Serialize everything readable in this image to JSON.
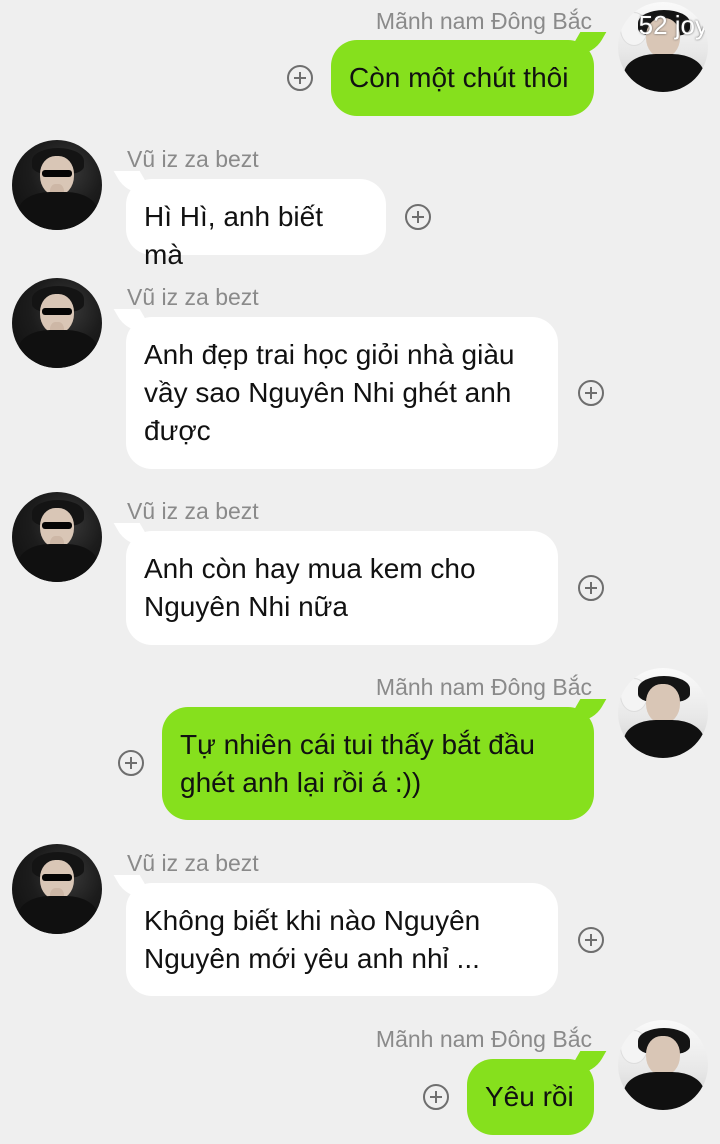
{
  "colors": {
    "background": "#efefef",
    "incoming_bubble": "#ffffff",
    "outgoing_bubble": "#86e01d",
    "sender_name": "#8a8a8a"
  },
  "overlay_text": "52 joy",
  "messages": [
    {
      "direction": "outgoing",
      "sender": "Mãnh nam Đông Bắc",
      "text": "Còn một chút thôi"
    },
    {
      "direction": "incoming",
      "sender": "Vũ iz za bezt",
      "text": "Hì Hì, anh biết mà"
    },
    {
      "direction": "incoming",
      "sender": "Vũ iz za bezt",
      "text": "Anh đẹp trai học giỏi nhà giàu vầy sao Nguyên Nhi ghét anh được"
    },
    {
      "direction": "incoming",
      "sender": "Vũ iz za bezt",
      "text": "Anh còn hay mua kem cho Nguyên Nhi nữa"
    },
    {
      "direction": "outgoing",
      "sender": "Mãnh nam Đông Bắc",
      "text": "Tự nhiên cái tui thấy bắt đầu ghét anh lại rồi á  :))"
    },
    {
      "direction": "incoming",
      "sender": "Vũ iz za bezt",
      "text": "Không biết khi nào Nguyên Nguyên mới yêu anh nhỉ ..."
    },
    {
      "direction": "outgoing",
      "sender": "Mãnh nam Đông Bắc",
      "text": "Yêu rồi"
    }
  ]
}
